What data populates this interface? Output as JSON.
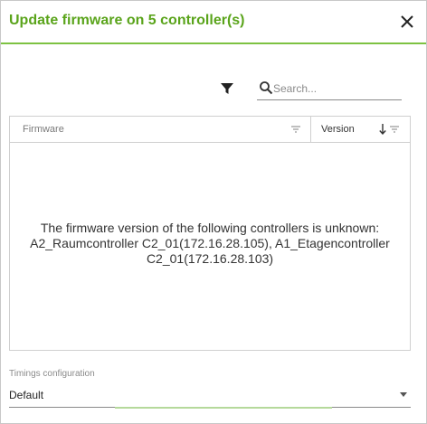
{
  "dialog": {
    "title": "Update firmware on 5 controller(s)",
    "accent_color": "#5aa41b"
  },
  "toolbar": {
    "filter_icon": "filter-icon",
    "search_placeholder": "Search...",
    "search_value": ""
  },
  "grid": {
    "columns": [
      {
        "label": "Firmware",
        "sort": "none"
      },
      {
        "label": "Version",
        "sort": "descending"
      }
    ],
    "message_lines": [
      "The firmware version of the following controllers is unknown:",
      "A2_Raumcontroller C2_01(172.16.28.105), A1_Etagencontroller",
      "C2_01(172.16.28.103)"
    ]
  },
  "timings": {
    "label": "Timings configuration",
    "selected": "Default"
  }
}
